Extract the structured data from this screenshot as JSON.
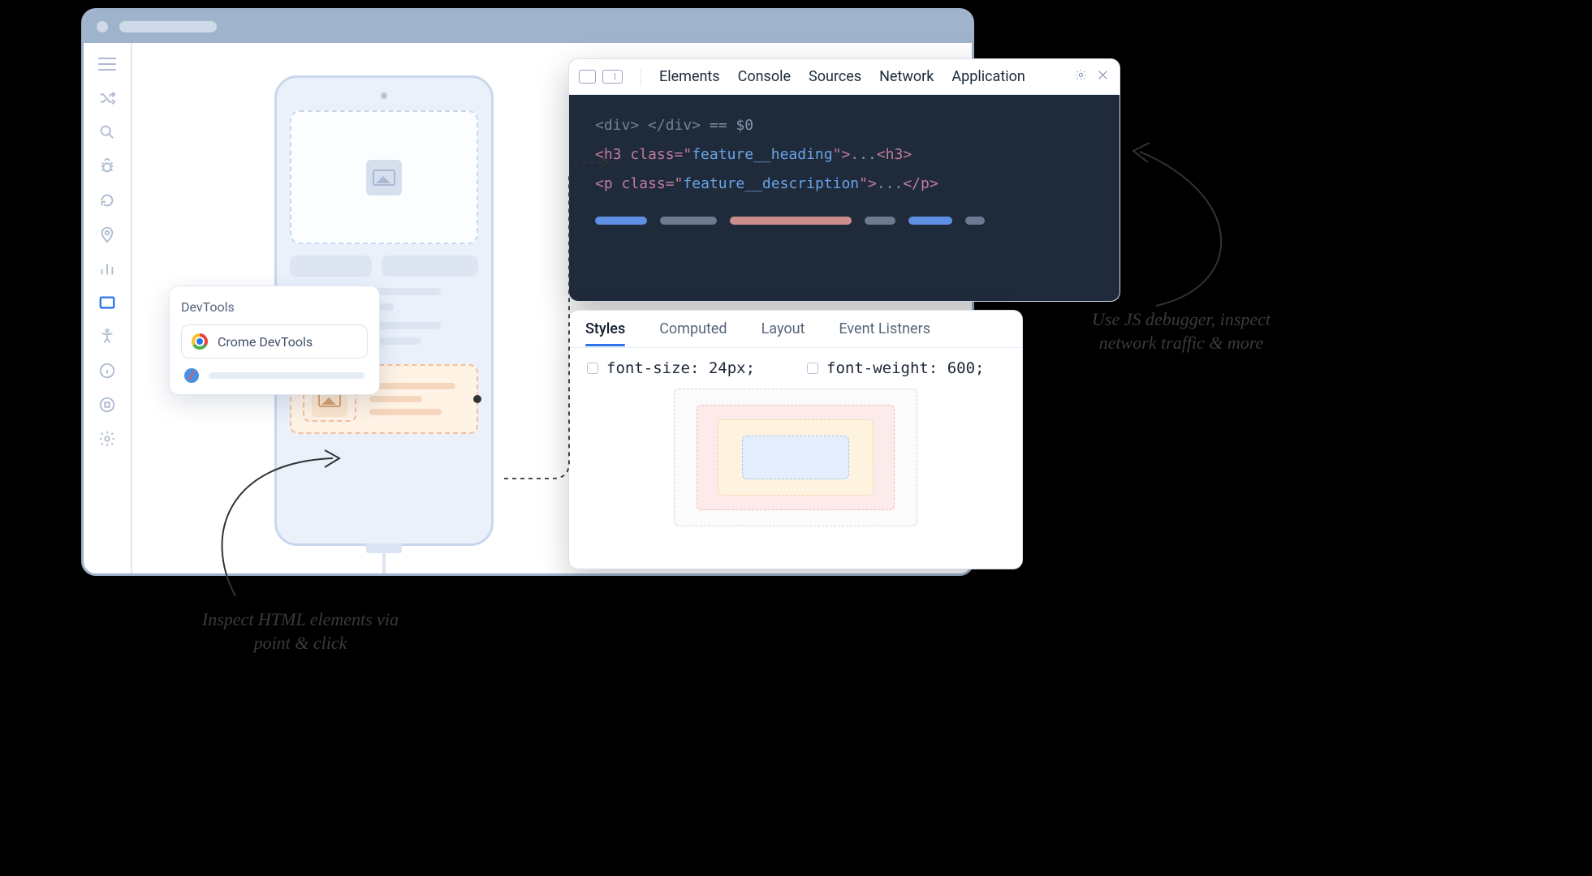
{
  "popover": {
    "title": "DevTools",
    "item_label": "Crome DevTools"
  },
  "devtools": {
    "tabs": [
      "Elements",
      "Console",
      "Sources",
      "Network",
      "Application"
    ],
    "code": {
      "l1a": "<div>",
      "l1b": " </div>",
      "l1c": " == $0",
      "l2o": "<h3",
      "l2a": " class=",
      "l2q": "\"",
      "l2s": "feature__heading",
      "l2c": ">",
      "l2d": "...",
      "l2e": "<h3>",
      "l3o": "<p",
      "l3a": " class=",
      "l3s": "feature__description",
      "l3c": ">",
      "l3d": "...",
      "l3e": "</p>"
    }
  },
  "styles": {
    "tabs": [
      "Styles",
      "Computed",
      "Layout",
      "Event Listners"
    ],
    "prop1": "font-size: 24px;",
    "prop2": "font-weight: 600;"
  },
  "annotations": {
    "a1": "Inspect HTML elements via point & click",
    "a2": "Use JS debugger, inspect network traffic & more"
  }
}
